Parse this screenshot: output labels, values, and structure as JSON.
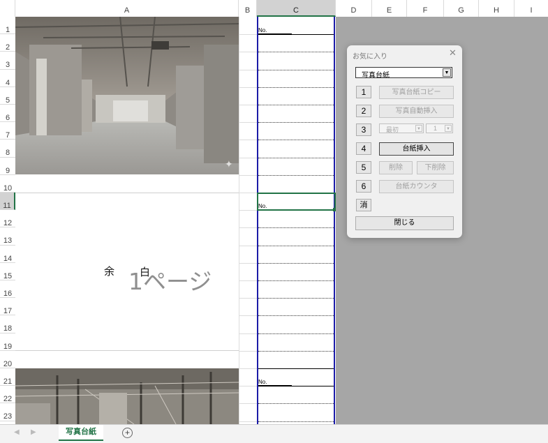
{
  "columns": [
    "A",
    "B",
    "C",
    "D",
    "E",
    "F",
    "G",
    "H",
    "I"
  ],
  "rows": [
    "1",
    "2",
    "3",
    "4",
    "5",
    "6",
    "7",
    "8",
    "9",
    "10",
    "11",
    "12",
    "13",
    "14",
    "15",
    "16",
    "17",
    "18",
    "19",
    "20",
    "21",
    "22",
    "23"
  ],
  "selected_column": "C",
  "selected_row": "11",
  "cells": {
    "no_label": "No.",
    "margin_char_1": "余",
    "margin_char_2": "白",
    "page_label": "1ページ"
  },
  "dialog": {
    "title": "お気に入り",
    "close_glyph": "✕",
    "selected_option": "写真台紙",
    "buttons": [
      {
        "num": "1",
        "label": "写真台紙コピー",
        "enabled": false
      },
      {
        "num": "2",
        "label": "写真自動挿入",
        "enabled": false
      },
      {
        "num": "3",
        "label": "",
        "enabled": false
      },
      {
        "num": "4",
        "label": "台紙挿入",
        "enabled": true
      },
      {
        "num": "5",
        "label": "削除",
        "enabled": false
      },
      {
        "num": "6",
        "label": "台紙カウンタ",
        "enabled": false
      }
    ],
    "row3_dropdown_1": "最初",
    "row3_dropdown_2": "1",
    "delete_bottom_label": "下削除",
    "clear_button": "消",
    "close_button": "閉じる"
  },
  "sheet_tabs": [
    "写真台紙"
  ],
  "add_sheet_glyph": "+",
  "icons": {
    "scroll_left": "left-arrow-icon",
    "scroll_right": "right-arrow-icon",
    "add_sheet": "plus-circle-icon",
    "dropdown": "triangle-down-icon"
  },
  "colors": {
    "accent": "#217346",
    "column_border": "#1b1ba8",
    "gray_area": "#a6a6a6"
  }
}
